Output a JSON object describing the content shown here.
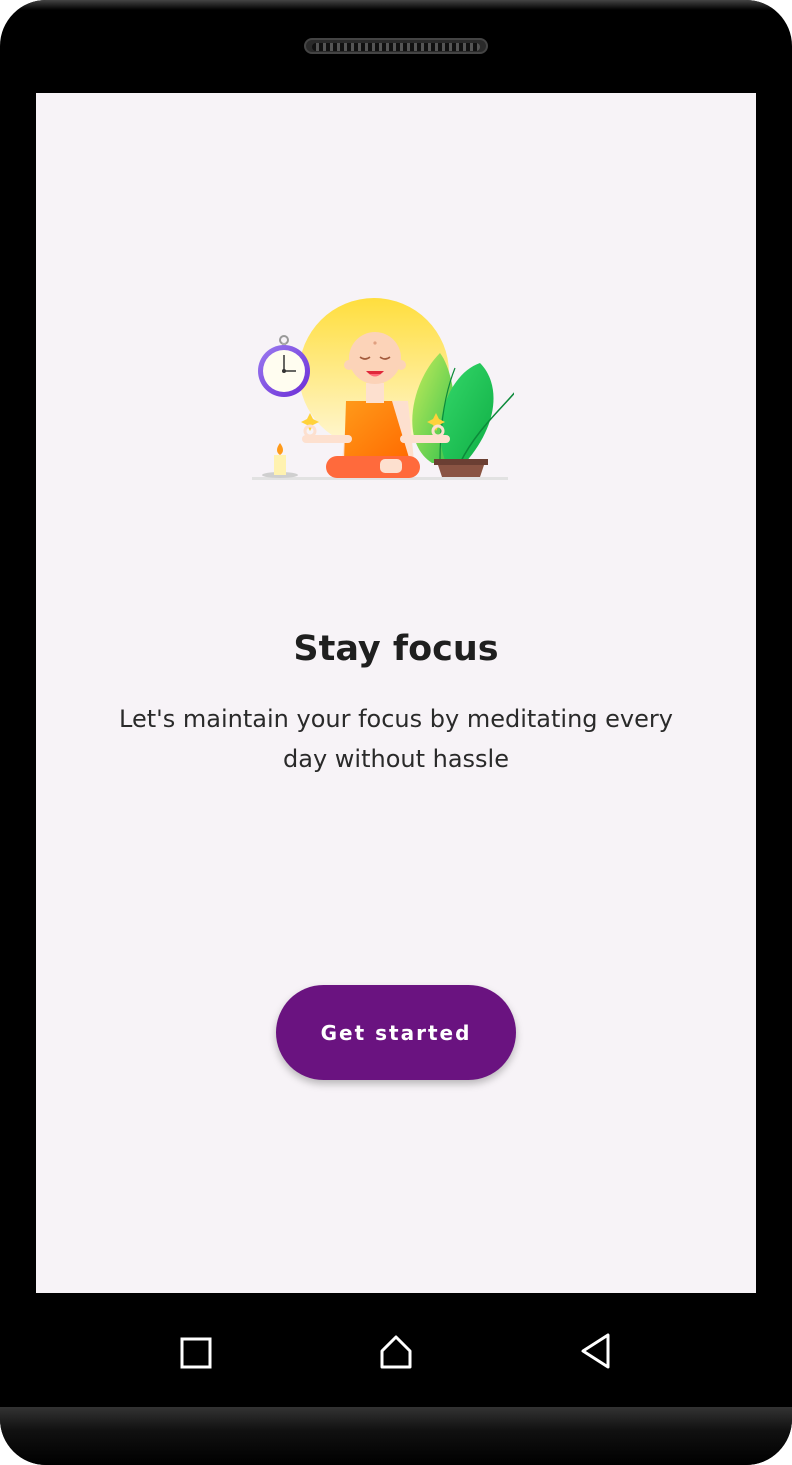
{
  "onboarding": {
    "title": "Stay focus",
    "subtitle": "Let's maintain your focus by meditating every day without hassle",
    "cta_label": "Get started"
  },
  "colors": {
    "background": "#f7f3f7",
    "accent": "#6a1380",
    "text": "#1f1f1f"
  },
  "navigation": {
    "icons": [
      "recents-square-icon",
      "home-icon",
      "back-triangle-icon"
    ]
  }
}
